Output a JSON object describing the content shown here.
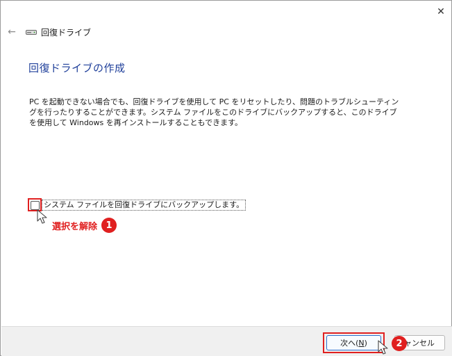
{
  "window": {
    "breadcrumb": "回復ドライブ",
    "close_glyph": "✕",
    "back_glyph": "←"
  },
  "main": {
    "title": "回復ドライブの作成",
    "description": "PC を起動できない場合でも、回復ドライブを使用して PC をリセットしたり、問題のトラブルシューティングを行ったりすることができます。システム ファイルをこのドライブにバックアップすると、このドライブを使用して Windows を再インストールすることもできます。",
    "checkbox_label": "システム ファイルを回復ドライブにバックアップします。",
    "checkbox_checked": false
  },
  "annotations": {
    "step1_text": "選択を解除",
    "step1_num": "1",
    "step2_num": "2",
    "color": "#e02020"
  },
  "footer": {
    "next_label_prefix": "次へ(",
    "next_label_key": "N",
    "next_label_suffix": ")",
    "cancel_label": "キャンセル"
  }
}
